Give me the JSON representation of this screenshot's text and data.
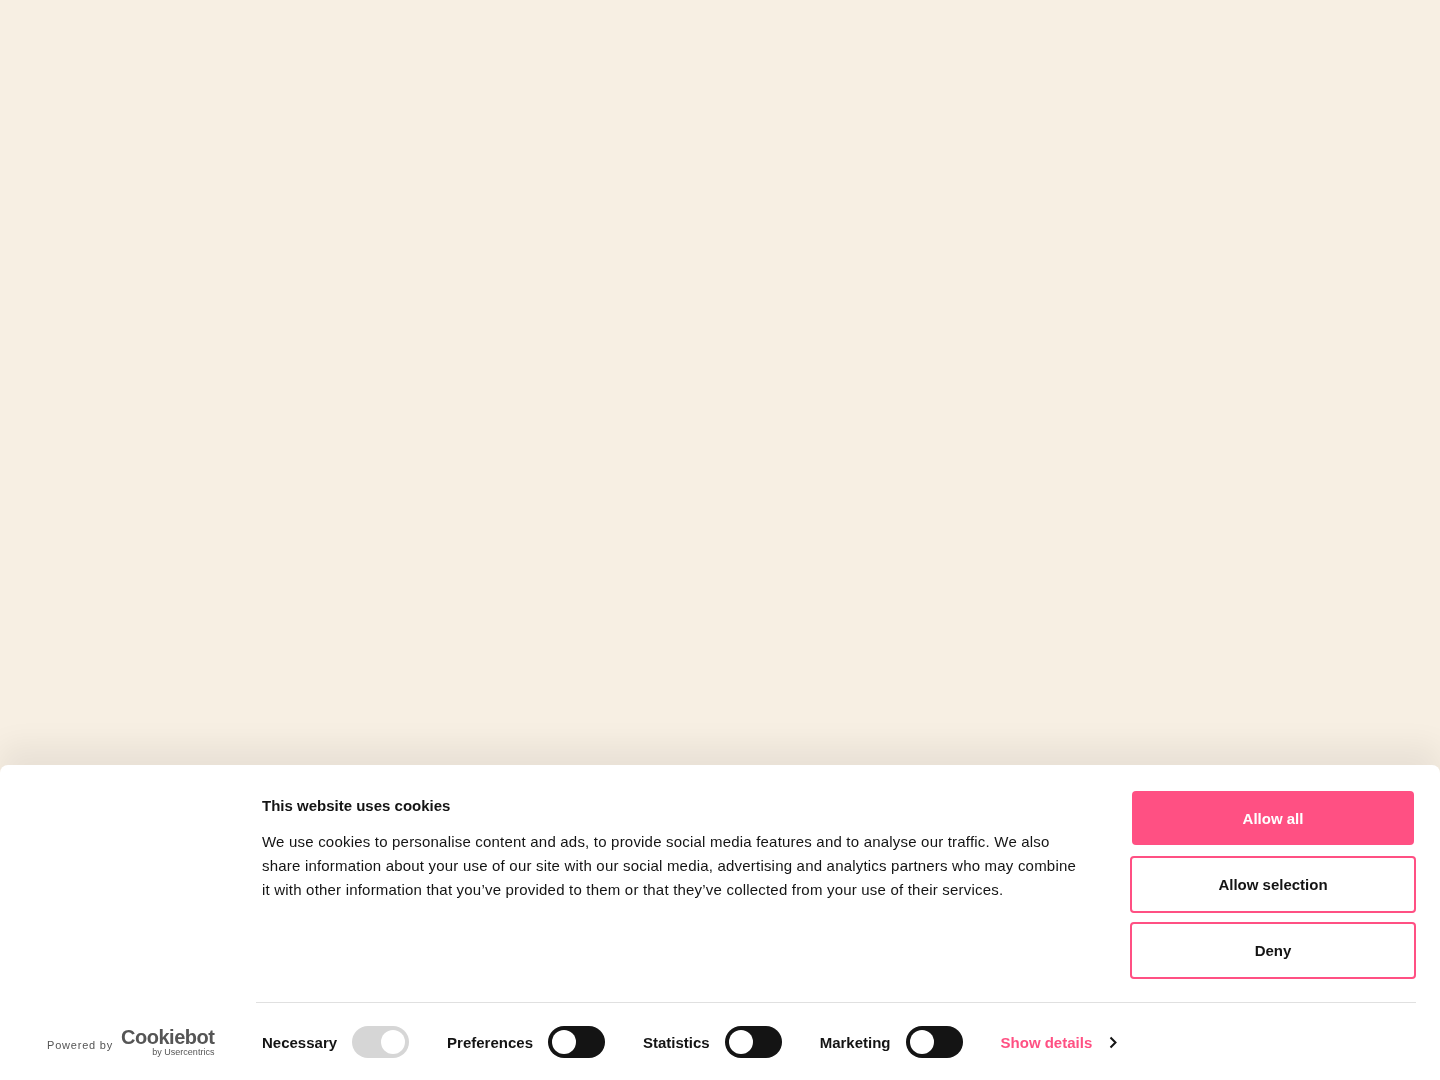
{
  "banner": {
    "title": "This website uses cookies",
    "text": "We use cookies to personalise content and ads, to provide social media features and to analyse our traffic. We also share information about your use of our site with our social media, advertising and analytics partners who may combine it with other information that you’ve provided to them or that they’ve collected from your use of their services.",
    "buttons": [
      {
        "label": "Allow all",
        "kind": "primary"
      },
      {
        "label": "Allow selection",
        "kind": "outline"
      },
      {
        "label": "Deny",
        "kind": "outline"
      }
    ],
    "powered_by": "Powered by",
    "logo": "Cookiebot",
    "logo_sub": "by Usercentrics",
    "toggles": [
      {
        "label": "Necessary",
        "on": true,
        "disabled": true
      },
      {
        "label": "Preferences",
        "on": false,
        "disabled": false
      },
      {
        "label": "Statistics",
        "on": false,
        "disabled": false
      },
      {
        "label": "Marketing",
        "on": false,
        "disabled": false
      }
    ],
    "details_link": "Show details"
  }
}
